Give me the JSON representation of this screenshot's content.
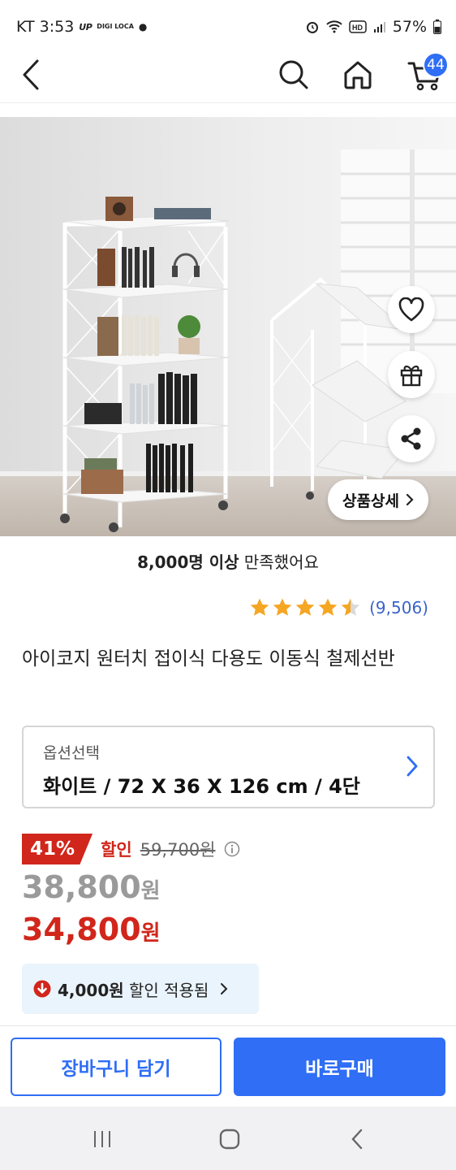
{
  "status_bar": {
    "carrier_time": "KT 3:53",
    "extra_1": "UP",
    "extra_2": "DIGI LOCA",
    "battery": "57%",
    "icons": [
      "alarm-icon",
      "wifi-icon",
      "hd-icon",
      "signal-icon",
      "battery-icon"
    ]
  },
  "header": {
    "cart_count": "44",
    "icons": [
      "back-icon",
      "search-icon",
      "home-icon",
      "cart-icon"
    ],
    "accent": "#2f6ef5"
  },
  "hero": {
    "detail_label": "상품상세",
    "dots_count": 9,
    "fab_icons": [
      "heart-icon",
      "gift-icon",
      "share-icon"
    ]
  },
  "satisfaction": {
    "bold": "8,000명 이상",
    "rest": " 만족했어요"
  },
  "rating": {
    "value": 4.5,
    "review_count": "(9,506)",
    "star_color": "#f5a623"
  },
  "product": {
    "title": "아이코지 원터치 접이식 다용도 이동식 철제선반"
  },
  "option": {
    "label": "옵션선택",
    "value": "화이트 / 72 X 36 X 126 cm / 4단"
  },
  "price": {
    "discount_rate": "41%",
    "discount_label": "할인",
    "original": "59,700원",
    "sale_num": "38,800",
    "final_num": "34,800",
    "unit": "원",
    "discount_color": "#d1261b"
  },
  "coupon": {
    "amount": "4,000원",
    "text": " 할인 적용됨"
  },
  "actions": {
    "cart_label": "장바구니 담기",
    "buy_label": "바로구매"
  }
}
